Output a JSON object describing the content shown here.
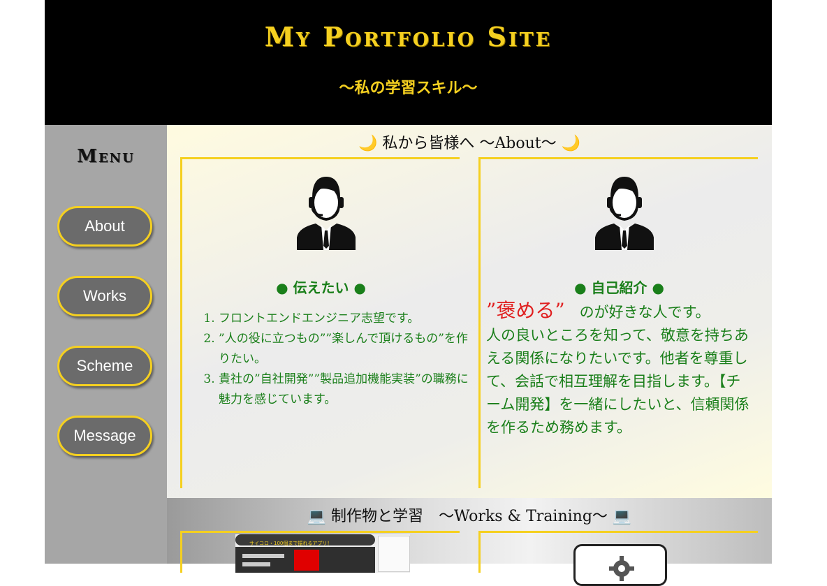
{
  "header": {
    "title": "My Portfolio Site",
    "subtitle": "〜私の学習スキル〜"
  },
  "sidebar": {
    "menu_title": "Menu",
    "items": [
      {
        "label": "About"
      },
      {
        "label": "Works"
      },
      {
        "label": "Scheme"
      },
      {
        "label": "Message"
      }
    ]
  },
  "about": {
    "heading": "🌙 私から皆様へ 〜About〜 🌙",
    "left_card": {
      "heading": "● 伝えたい ●",
      "items": [
        "フロントエンドエンジニア志望です。",
        "”人の役に立つもの””楽しんで頂けるもの”を作りたい。",
        "貴社の”自社開発””製品追加機能実装”の職務に魅力を感じています。"
      ]
    },
    "right_card": {
      "heading": "● 自己紹介 ●",
      "praise": "”褒める”",
      "praise_suffix": "　のが好きな人です。",
      "body": "人の良いところを知って、敬意を持ちあえる関係になりたいです。他者を尊重して、会話で相互理解を目指します。【チーム開発】を一緒にしたいと、信頼関係を作るため務めます。"
    }
  },
  "works": {
    "heading": "💻 制作物と学習　〜Works & Training〜 💻",
    "thumb_title": "サイコロ・100個まで振れるアプリ！"
  },
  "colors": {
    "accent": "#f5d020",
    "header_bg": "#000000",
    "sidebar_bg": "#a6a6a6",
    "button_bg": "#6b6b6b",
    "text_green": "#1a7f1a",
    "praise_red": "#e01e1e"
  }
}
